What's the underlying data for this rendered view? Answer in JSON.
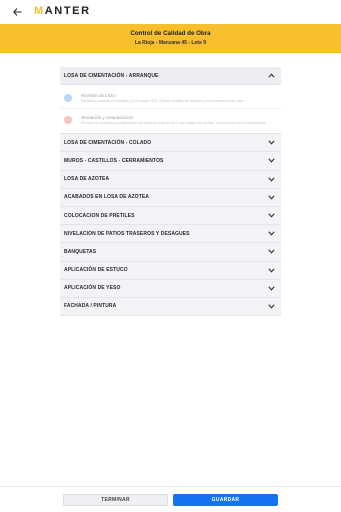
{
  "header": {
    "brand_first": "M",
    "brand_rest": "ANTER"
  },
  "banner": {
    "title": "Control de Calidad de Obra",
    "subtitle": "La Rioja - Manzana 45 - Lote 9"
  },
  "sections": [
    {
      "label": "LOSA DE CIMENTACIÓN - ARRANQUE",
      "open": true,
      "subitems": [
        {
          "title": "Revisión de trazo",
          "desc": "Revisión concuerde en medidas y (1.0) trazado NTA, Revisar medidas de escuadra y otros elementos del trazo",
          "color": "#b8d7f2"
        },
        {
          "title": "Nivelación y compactación",
          "desc": "Revisión de nivelación y compactación del suelo de acuerdo con lo que indique las normas. Control dentro de la especificación",
          "color": "#f8c3c0"
        }
      ]
    },
    {
      "label": "LOSA DE CIMENTACIÓN - COLADO"
    },
    {
      "label": "MUROS - CASTILLOS - CERRAMIENTOS"
    },
    {
      "label": "LOSA DE AZOTEA"
    },
    {
      "label": "ACABADOS EN LOSA DE AZOTEA"
    },
    {
      "label": "COLOCACION DE PRETILES"
    },
    {
      "label": "NIVELACION DE PATIOS TRASEROS Y DESAGUES"
    },
    {
      "label": "BANQUETAS"
    },
    {
      "label": "APLICACIÓN DE ESTUCO"
    },
    {
      "label": "APLICACIÓN DE YESO"
    },
    {
      "label": "FACHADA / PINTURA"
    }
  ],
  "footer": {
    "terminate_label": "TERMINAR",
    "save_label": "GUARDAR"
  },
  "colors": {
    "accent": "#f7be2e",
    "primary": "#1673f0"
  }
}
